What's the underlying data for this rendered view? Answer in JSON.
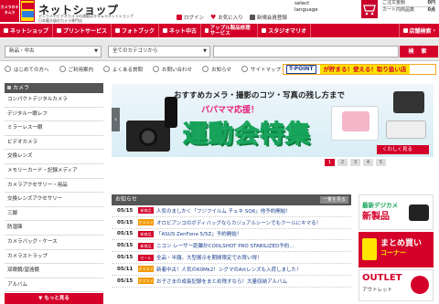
{
  "header": {
    "logo_text": "カメラのキタムラ",
    "title": "ネットショップ",
    "subtitle_1": "デジカメやビデオカメラの通販はキタムラネットショップ",
    "subtitle_2": "日本最大級のカメラ専門店",
    "links": [
      {
        "label": "ログイン",
        "icon": "login-icon",
        "color": "#d4002a"
      },
      {
        "label": "お気に入り",
        "icon": "heart-icon",
        "color": "#d4002a"
      },
      {
        "label": "新規会員登録",
        "icon": "register-icon",
        "color": "#555555"
      }
    ],
    "language": "select language",
    "cart": {
      "label": "ご注文金額",
      "amount": "0円",
      "count_label": "カート内商品数",
      "count": "0点"
    }
  },
  "nav": {
    "items": [
      {
        "label": "ネットショップ"
      },
      {
        "label": "プリントサービス"
      },
      {
        "label": "フォトブック"
      },
      {
        "label": "ネット中古"
      },
      {
        "label": "アップル製品修理サービス"
      },
      {
        "label": "スタジオマリオ"
      }
    ],
    "store": "店舗検索"
  },
  "search": {
    "category": "新品・中古",
    "all_categories": "全てのカテゴリから",
    "placeholder": "",
    "button": "検 索"
  },
  "sublinks": [
    {
      "label": "はじめての方へ"
    },
    {
      "label": "ご利用案内"
    },
    {
      "label": "よくある質問"
    },
    {
      "label": "お問い合わせ"
    },
    {
      "label": "お知らせ"
    },
    {
      "label": "サイトマップ"
    }
  ],
  "tpoint": {
    "logo": "T-POINT",
    "message": "が貯まる！使える！取り扱い店"
  },
  "sidebar": {
    "header": "カメラ",
    "items": [
      "コンパクトデジタルカメラ",
      "デジタル一眼レフ",
      "ミラーレス一眼",
      "ビデオカメラ",
      "交換レンズ",
      "メモリーカード・記録メディア",
      "カメラアクセサリー・用品",
      "交換レンズアクセサリー",
      "三脚",
      "防湿庫",
      "カメラバッグ・ケース",
      "カメラストラップ",
      "双眼鏡/望遠鏡",
      "アルバム"
    ],
    "more": "もっと見る"
  },
  "banner": {
    "subtitle": "おすすめカメラ・撮影のコツ・写真の残し方まで",
    "mid": "パパママ応援！",
    "main": "運動会特集",
    "detail": "くわしく見る",
    "pages": [
      "1",
      "2",
      "3",
      "4",
      "5"
    ],
    "active_page": "1"
  },
  "news": {
    "header": "お知らせ",
    "all": "一覧を見る",
    "items": [
      {
        "date": "05/15",
        "tag": "新商品",
        "tag_color": "#d4002a",
        "text": "人気のましかく「フジフイルム チェキ SQ6」他予約開始！"
      },
      {
        "date": "05/15",
        "tag": "オススメ",
        "tag_color": "#f39800",
        "text": "オロビアンコのボディバッグならカジュアルシーンでもクールにキマる！"
      },
      {
        "date": "05/15",
        "tag": "新商品",
        "tag_color": "#d4002a",
        "text": "「ASUS ZenFone 5/5Z」予約開始！"
      },
      {
        "date": "05/15",
        "tag": "新商品",
        "tag_color": "#d4002a",
        "text": "ニコン レーザー距離計COOLSHOT PRO STABILIZED予約..."
      },
      {
        "date": "05/15",
        "tag": "セール",
        "tag_color": "#d4002a",
        "text": "全品・半額。大型展示を期間限定でお買い得！"
      },
      {
        "date": "05/11",
        "tag": "オススメ",
        "tag_color": "#f39800",
        "text": "新着中古！人気の60Mk2！シグマのArtレンズも入荷しました！"
      },
      {
        "date": "05/15",
        "tag": "オススメ",
        "tag_color": "#f39800",
        "text": "お子さまの成長記録をまとめ残すなら！大量収納アルバム"
      }
    ]
  },
  "promos": {
    "p1_line1": "最新デジカメ",
    "p1_line2": "新製品",
    "p2_line1": "まとめ買い",
    "p2_line2": "コーナー",
    "p3_line1": "OUTLET",
    "p3_line2": "アウトレット"
  }
}
